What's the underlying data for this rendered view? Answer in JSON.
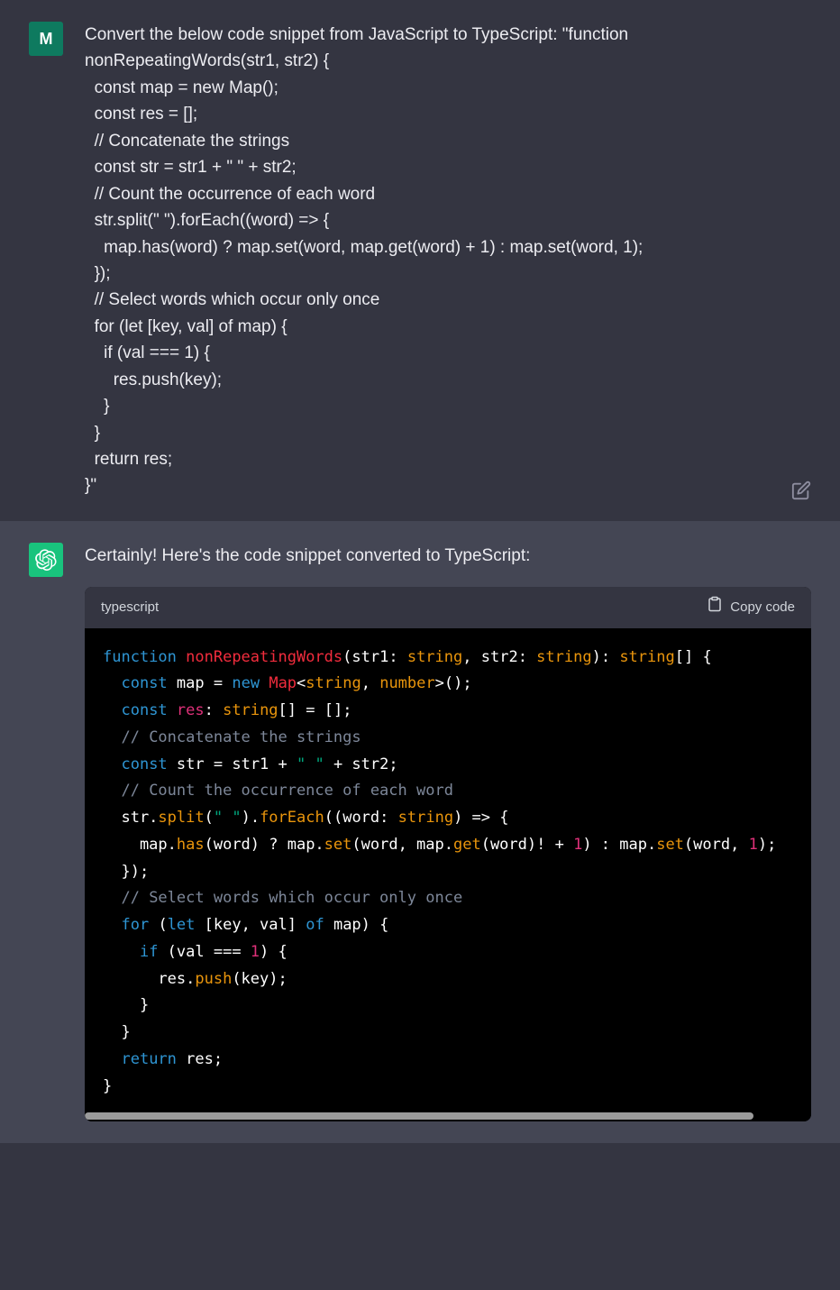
{
  "user": {
    "avatar_initial": "M",
    "message": "Convert the below code snippet from JavaScript to TypeScript: \"function nonRepeatingWords(str1, str2) {\n  const map = new Map();\n  const res = [];\n  // Concatenate the strings\n  const str = str1 + \" \" + str2;\n  // Count the occurrence of each word\n  str.split(\" \").forEach((word) => {\n    map.has(word) ? map.set(word, map.get(word) + 1) : map.set(word, 1);\n  });\n  // Select words which occur only once\n  for (let [key, val] of map) {\n    if (val === 1) {\n      res.push(key);\n    }\n  }\n  return res;\n}\""
  },
  "assistant": {
    "intro": "Certainly! Here's the code snippet converted to TypeScript:",
    "code_language": "typescript",
    "copy_label": "Copy code",
    "code_tokens": [
      [
        [
          "kw",
          "function"
        ],
        [
          "punc",
          " "
        ],
        [
          "fn",
          "nonRepeatingWords"
        ],
        [
          "punc",
          "("
        ],
        [
          "var",
          "str1"
        ],
        [
          "punc",
          ": "
        ],
        [
          "builtin",
          "string"
        ],
        [
          "punc",
          ", "
        ],
        [
          "var",
          "str2"
        ],
        [
          "punc",
          ": "
        ],
        [
          "builtin",
          "string"
        ],
        [
          "punc",
          "): "
        ],
        [
          "builtin",
          "string"
        ],
        [
          "punc",
          "[] {"
        ]
      ],
      [
        [
          "punc",
          "  "
        ],
        [
          "kw",
          "const"
        ],
        [
          "punc",
          " "
        ],
        [
          "var",
          "map"
        ],
        [
          "punc",
          " = "
        ],
        [
          "kw",
          "new"
        ],
        [
          "punc",
          " "
        ],
        [
          "fn",
          "Map"
        ],
        [
          "punc",
          "<"
        ],
        [
          "builtin",
          "string"
        ],
        [
          "punc",
          ", "
        ],
        [
          "builtin",
          "number"
        ],
        [
          "punc",
          ">();"
        ]
      ],
      [
        [
          "punc",
          "  "
        ],
        [
          "kw",
          "const"
        ],
        [
          "punc",
          " "
        ],
        [
          "prop",
          "res"
        ],
        [
          "punc",
          ": "
        ],
        [
          "builtin",
          "string"
        ],
        [
          "punc",
          "[] = [];"
        ]
      ],
      [
        [
          "punc",
          "  "
        ],
        [
          "com",
          "// Concatenate the strings"
        ]
      ],
      [
        [
          "punc",
          "  "
        ],
        [
          "kw",
          "const"
        ],
        [
          "punc",
          " "
        ],
        [
          "var",
          "str"
        ],
        [
          "punc",
          " = str1 + "
        ],
        [
          "str",
          "\" \""
        ],
        [
          "punc",
          " + str2;"
        ]
      ],
      [
        [
          "punc",
          "  "
        ],
        [
          "com",
          "// Count the occurrence of each word"
        ]
      ],
      [
        [
          "punc",
          "  str."
        ],
        [
          "method",
          "split"
        ],
        [
          "punc",
          "("
        ],
        [
          "str",
          "\" \""
        ],
        [
          "punc",
          "),"
        ],
        [
          "punc",
          "."
        ],
        [
          "method",
          "forEach"
        ],
        [
          "punc",
          "(("
        ],
        [
          "var",
          "word"
        ],
        [
          "punc",
          ": "
        ],
        [
          "builtin",
          "string"
        ],
        [
          "punc",
          ") => {"
        ]
      ],
      [
        [
          "punc",
          "    map."
        ],
        [
          "method",
          "has"
        ],
        [
          "punc",
          "(word) ? map."
        ],
        [
          "method",
          "set"
        ],
        [
          "punc",
          "(word, map."
        ],
        [
          "method",
          "get"
        ],
        [
          "punc",
          "(word)! + "
        ],
        [
          "num",
          "1"
        ],
        [
          "punc",
          ") : map."
        ],
        [
          "method",
          "set"
        ],
        [
          "punc",
          "(word, "
        ],
        [
          "num",
          "1"
        ],
        [
          "punc",
          ");"
        ]
      ],
      [
        [
          "punc",
          "  });"
        ]
      ],
      [
        [
          "punc",
          "  "
        ],
        [
          "com",
          "// Select words which occur only once"
        ]
      ],
      [
        [
          "punc",
          "  "
        ],
        [
          "kw",
          "for"
        ],
        [
          "punc",
          " ("
        ],
        [
          "kw",
          "let"
        ],
        [
          "punc",
          " [key, val] "
        ],
        [
          "kw",
          "of"
        ],
        [
          "punc",
          " map) {"
        ]
      ],
      [
        [
          "punc",
          "    "
        ],
        [
          "kw",
          "if"
        ],
        [
          "punc",
          " (val === "
        ],
        [
          "num",
          "1"
        ],
        [
          "punc",
          ") {"
        ]
      ],
      [
        [
          "punc",
          "      res."
        ],
        [
          "method",
          "push"
        ],
        [
          "punc",
          "(key);"
        ]
      ],
      [
        [
          "punc",
          "    }"
        ]
      ],
      [
        [
          "punc",
          "  }"
        ]
      ],
      [
        [
          "punc",
          "  "
        ],
        [
          "kw",
          "return"
        ],
        [
          "punc",
          " res;"
        ]
      ],
      [
        [
          "punc",
          "}"
        ]
      ]
    ],
    "code_tokens_fixed": [
      [
        [
          "kw",
          "function"
        ],
        [
          "punc",
          " "
        ],
        [
          "fn",
          "nonRepeatingWords"
        ],
        [
          "punc",
          "("
        ],
        [
          "var",
          "str1"
        ],
        [
          "punc",
          ": "
        ],
        [
          "builtin",
          "string"
        ],
        [
          "punc",
          ", "
        ],
        [
          "var",
          "str2"
        ],
        [
          "punc",
          ": "
        ],
        [
          "builtin",
          "string"
        ],
        [
          "punc",
          "): "
        ],
        [
          "builtin",
          "string"
        ],
        [
          "punc",
          "[] {"
        ]
      ],
      [
        [
          "punc",
          "  "
        ],
        [
          "kw",
          "const"
        ],
        [
          "punc",
          " "
        ],
        [
          "var",
          "map"
        ],
        [
          "punc",
          " = "
        ],
        [
          "kw",
          "new"
        ],
        [
          "punc",
          " "
        ],
        [
          "fn",
          "Map"
        ],
        [
          "punc",
          "<"
        ],
        [
          "builtin",
          "string"
        ],
        [
          "punc",
          ", "
        ],
        [
          "builtin",
          "number"
        ],
        [
          "punc",
          ">();"
        ]
      ],
      [
        [
          "punc",
          "  "
        ],
        [
          "kw",
          "const"
        ],
        [
          "punc",
          " "
        ],
        [
          "prop",
          "res"
        ],
        [
          "punc",
          ": "
        ],
        [
          "builtin",
          "string"
        ],
        [
          "punc",
          "[] = [];"
        ]
      ],
      [
        [
          "punc",
          "  "
        ],
        [
          "com",
          "// Concatenate the strings"
        ]
      ],
      [
        [
          "punc",
          "  "
        ],
        [
          "kw",
          "const"
        ],
        [
          "punc",
          " "
        ],
        [
          "var",
          "str"
        ],
        [
          "punc",
          " = str1 + "
        ],
        [
          "str",
          "\" \""
        ],
        [
          "punc",
          " + str2;"
        ]
      ],
      [
        [
          "punc",
          "  "
        ],
        [
          "com",
          "// Count the occurrence of each word"
        ]
      ],
      [
        [
          "punc",
          "  str."
        ],
        [
          "method",
          "split"
        ],
        [
          "punc",
          "("
        ],
        [
          "str",
          "\" \""
        ],
        [
          "punc",
          ")."
        ],
        [
          "method",
          "forEach"
        ],
        [
          "punc",
          "(("
        ],
        [
          "var",
          "word"
        ],
        [
          "punc",
          ": "
        ],
        [
          "builtin",
          "string"
        ],
        [
          "punc",
          ") => {"
        ]
      ],
      [
        [
          "punc",
          "    map."
        ],
        [
          "method",
          "has"
        ],
        [
          "punc",
          "(word) ? map."
        ],
        [
          "method",
          "set"
        ],
        [
          "punc",
          "(word, map."
        ],
        [
          "method",
          "get"
        ],
        [
          "punc",
          "(word)! + "
        ],
        [
          "num",
          "1"
        ],
        [
          "punc",
          ") : map."
        ],
        [
          "method",
          "set"
        ],
        [
          "punc",
          "(word, "
        ],
        [
          "num",
          "1"
        ],
        [
          "punc",
          ");"
        ]
      ],
      [
        [
          "punc",
          "  });"
        ]
      ],
      [
        [
          "punc",
          "  "
        ],
        [
          "com",
          "// Select words which occur only once"
        ]
      ],
      [
        [
          "punc",
          "  "
        ],
        [
          "kw",
          "for"
        ],
        [
          "punc",
          " ("
        ],
        [
          "kw",
          "let"
        ],
        [
          "punc",
          " [key, val] "
        ],
        [
          "kw",
          "of"
        ],
        [
          "punc",
          " map) {"
        ]
      ],
      [
        [
          "punc",
          "    "
        ],
        [
          "kw",
          "if"
        ],
        [
          "punc",
          " (val === "
        ],
        [
          "num",
          "1"
        ],
        [
          "punc",
          ") {"
        ]
      ],
      [
        [
          "punc",
          "      res."
        ],
        [
          "method",
          "push"
        ],
        [
          "punc",
          "(key);"
        ]
      ],
      [
        [
          "punc",
          "    }"
        ]
      ],
      [
        [
          "punc",
          "  }"
        ]
      ],
      [
        [
          "punc",
          "  "
        ],
        [
          "kw",
          "return"
        ],
        [
          "punc",
          " res;"
        ]
      ],
      [
        [
          "punc",
          "}"
        ]
      ]
    ]
  }
}
